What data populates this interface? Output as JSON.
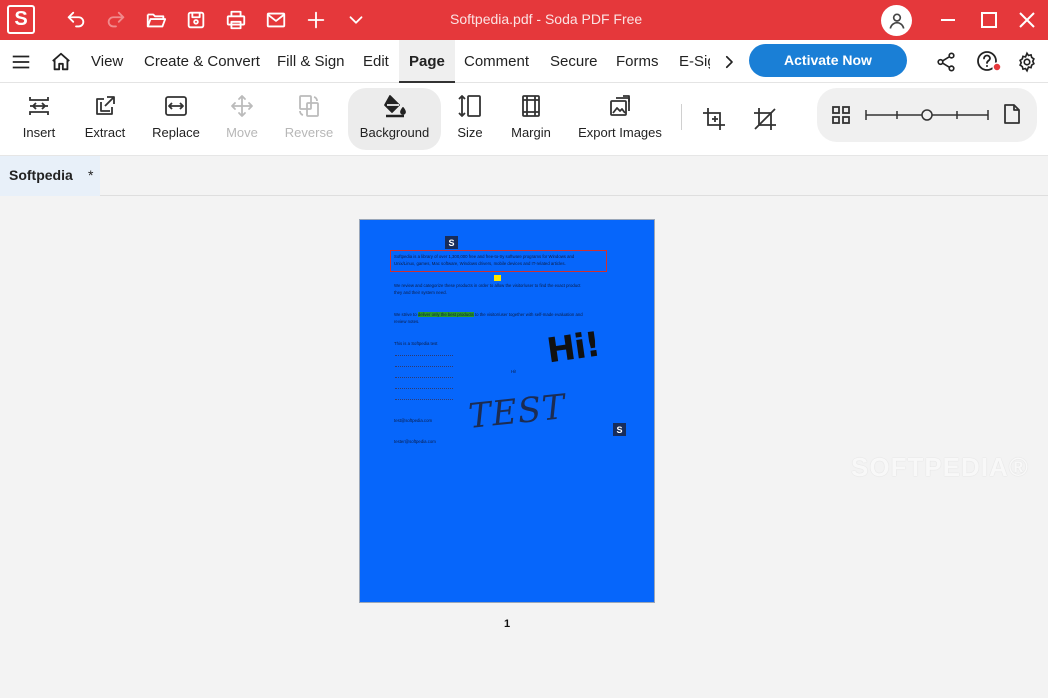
{
  "window": {
    "title": "Softpedia.pdf   -   Soda PDF Free",
    "app_logo": "S"
  },
  "quick_access": [
    "undo-icon",
    "redo-icon",
    "open-folder-icon",
    "save-icon",
    "print-icon",
    "email-icon",
    "add-icon",
    "chevron-down-icon"
  ],
  "menu": {
    "items": [
      "View",
      "Create & Convert",
      "Fill & Sign",
      "Edit",
      "Page",
      "Comment",
      "Secure",
      "Forms",
      "E-Sig"
    ],
    "active": "Page",
    "activate_label": "Activate Now"
  },
  "ribbon": {
    "insert": "Insert",
    "extract": "Extract",
    "replace": "Replace",
    "move": "Move",
    "reverse": "Reverse",
    "background": "Background",
    "size": "Size",
    "margin": "Margin",
    "export_images": "Export Images"
  },
  "tab": {
    "name": "Softpedia",
    "modified": "*"
  },
  "document": {
    "page_number": "1",
    "logo_letter": "S",
    "para1_l1": "Softpedia is a library of over 1,300,000 free and free-to-try software programs for Windows and",
    "para1_l2": "Unix/Linux, games, Mac software, Windows drivers, mobile devices and IT-related articles.",
    "para2_l1": "We review and categorize these products in order to allow the visitor/user to find the exact product",
    "para2_l2": "they and their system need.",
    "para3_pre": "We strive to ",
    "para3_hl": "deliver only the best products",
    "para3_post": " to the visitor/user together with self-made evaluation and",
    "para3_l2": "review notes.",
    "link_intro": "This is a Softpedia test",
    "small_hi": "Hi!",
    "email1": "test@softpedia.com",
    "email2": "tester@softpedia.com",
    "handwriting_hi": "Hi!",
    "handwriting_test": "TEST"
  },
  "watermark": "SOFTPEDIA®",
  "colors": {
    "title_bar": "#e5383b",
    "accent_button": "#1a7fd6",
    "page_background": "#0666fb"
  }
}
